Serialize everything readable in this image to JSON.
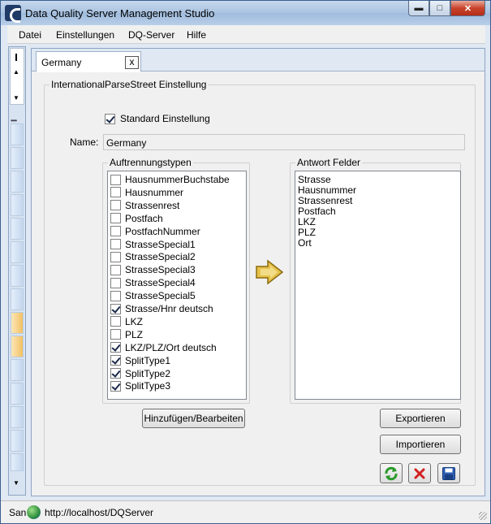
{
  "window": {
    "title": "Data Quality Server Management Studio"
  },
  "menu": {
    "items": [
      "Datei",
      "Einstellungen",
      "DQ-Server",
      "Hilfe"
    ]
  },
  "tab": {
    "label": "Germany",
    "close_label": "x"
  },
  "panel": {
    "group_title": "InternationalParseStreet Einstellung",
    "standard_label": "Standard Einstellung",
    "standard_checked": true,
    "name_label": "Name:",
    "name_value": "Germany"
  },
  "split_types": {
    "title": "Auftrennungstypen",
    "items": [
      {
        "label": "HausnummerBuchstabe",
        "checked": false
      },
      {
        "label": "Hausnummer",
        "checked": false
      },
      {
        "label": "Strassenrest",
        "checked": false
      },
      {
        "label": "Postfach",
        "checked": false
      },
      {
        "label": "PostfachNummer",
        "checked": false
      },
      {
        "label": "StrasseSpecial1",
        "checked": false
      },
      {
        "label": "StrasseSpecial2",
        "checked": false
      },
      {
        "label": "StrasseSpecial3",
        "checked": false
      },
      {
        "label": "StrasseSpecial4",
        "checked": false
      },
      {
        "label": "StrasseSpecial5",
        "checked": false
      },
      {
        "label": "Strasse/Hnr deutsch",
        "checked": true
      },
      {
        "label": "LKZ",
        "checked": false
      },
      {
        "label": "PLZ",
        "checked": false
      },
      {
        "label": "LKZ/PLZ/Ort deutsch",
        "checked": true
      },
      {
        "label": "SplitType1",
        "checked": true
      },
      {
        "label": "SplitType2",
        "checked": true
      },
      {
        "label": "SplitType3",
        "checked": true
      }
    ]
  },
  "answer_fields": {
    "title": "Antwort Felder",
    "items": [
      "Strasse",
      "Hausnummer",
      "Strassenrest",
      "Postfach",
      "LKZ",
      "PLZ",
      "Ort"
    ]
  },
  "buttons": {
    "add_edit": "Hinzufügen/Bearbeiten",
    "export": "Exportieren",
    "import": "Importieren"
  },
  "icons": {
    "refresh": "refresh-icon",
    "delete": "delete-icon",
    "save": "save-icon",
    "transfer_arrow": "arrow-right-icon"
  },
  "status": {
    "text": "San",
    "url": "http://localhost/DQServer"
  }
}
